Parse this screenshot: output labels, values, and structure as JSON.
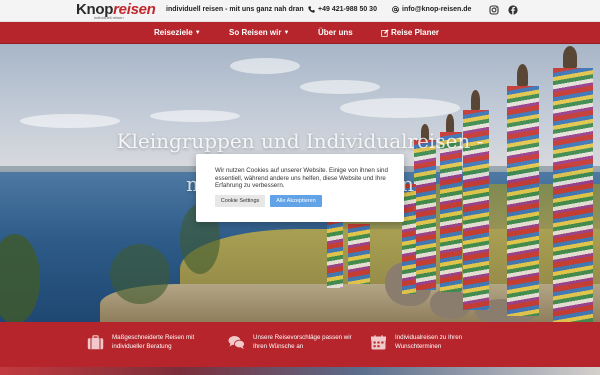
{
  "topbar": {
    "logo_main": "Knop",
    "logo_accent": "reisen",
    "logo_sub": "individuell reisen",
    "tagline": "individuell reisen - mit uns ganz nah dran",
    "phone": "+49 421-988 50 30",
    "email": "info@knop-reisen.de",
    "icons": [
      "phone-icon",
      "mail-icon",
      "instagram-icon",
      "facebook-icon"
    ]
  },
  "nav": {
    "items": [
      {
        "label": "Reiseziele",
        "dropdown": true
      },
      {
        "label": "So Reisen wir",
        "dropdown": true
      },
      {
        "label": "Über uns",
        "dropdown": false
      },
      {
        "label": "Reise Planer",
        "dropdown": false,
        "icon": "edit-icon"
      }
    ]
  },
  "hero": {
    "title_line1": "Kleingruppen und Individualreisen -",
    "title_line2": "mit uns ganz nah dran"
  },
  "cookie": {
    "text": "Wir nutzen Cookies auf unserer Website. Einige von ihnen sind essentiell, während andere uns helfen, diese Website und Ihre Erfahrung zu verbessern.",
    "settings_label": "Cookie Settings",
    "accept_label": "Alle Akzeptieren"
  },
  "features": [
    {
      "icon": "suitcase-icon",
      "text": "Maßgeschneiderte Reisen mit individueller Beratung"
    },
    {
      "icon": "chat-icon",
      "text": "Unsere Reisevorschläge passen wir Ihren Wünsche an"
    },
    {
      "icon": "calendar-icon",
      "text": "Individualreisen zu Ihren Wunschterminen"
    }
  ],
  "colors": {
    "brand_red": "#b5252b",
    "accept_blue": "#61a3e6",
    "topbar_bg": "#f4f4f4"
  }
}
